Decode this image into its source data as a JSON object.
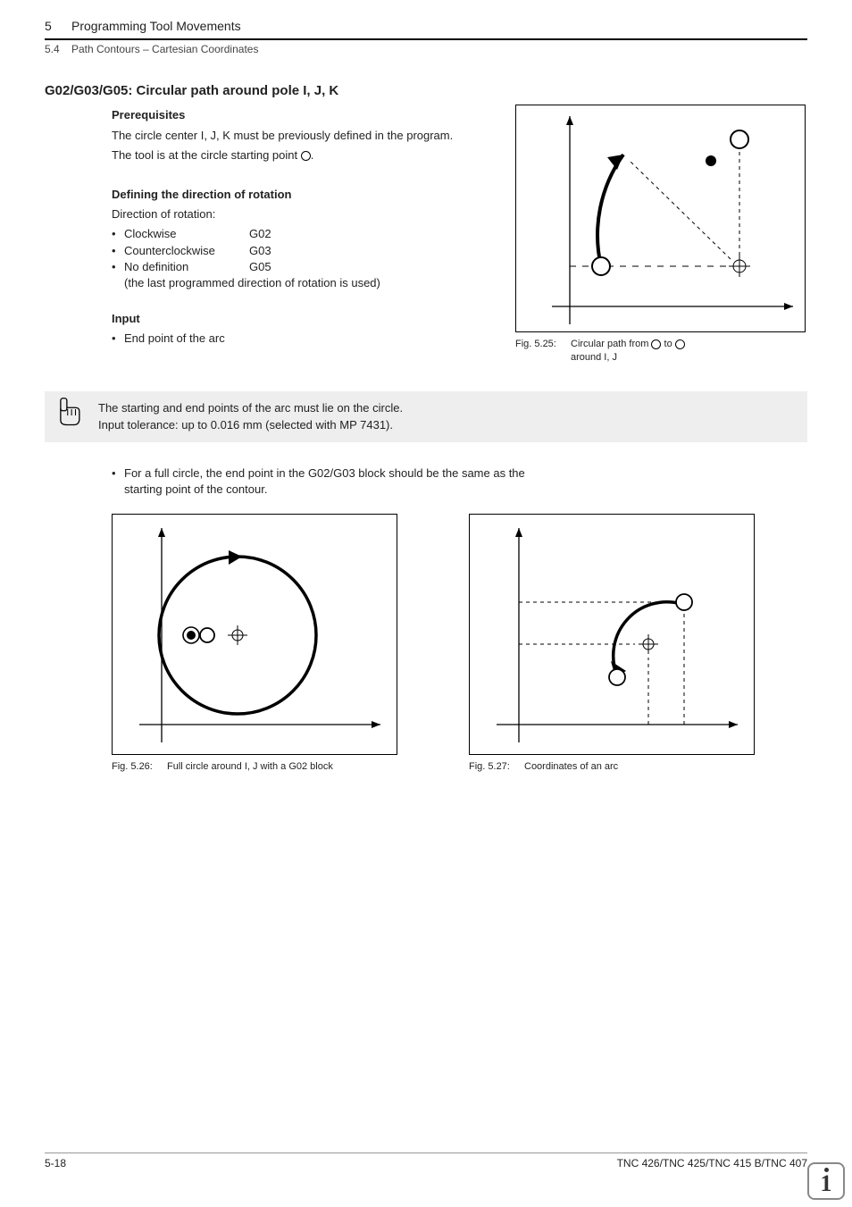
{
  "header": {
    "chapter_num": "5",
    "chapter_title": "Programming Tool Movements",
    "section_num": "5.4",
    "section_title": "Path Contours – Cartesian Coordinates"
  },
  "title": "G02/G03/G05: Circular path around pole I, J, K",
  "prereq": {
    "heading": "Prerequisites",
    "line1": "The circle center I, J, K must be previously defined in the program.",
    "line2a": "The tool is at the circle starting point ",
    "line2b": "."
  },
  "dir": {
    "heading": "Defining the direction of rotation",
    "intro": "Direction of rotation:",
    "items": [
      {
        "label": "Clockwise",
        "code": "G02"
      },
      {
        "label": "Counterclockwise",
        "code": "G03"
      },
      {
        "label": "No definition",
        "code": "G05"
      }
    ],
    "note": "(the last programmed direction of rotation is used)"
  },
  "input": {
    "heading": "Input",
    "item": "End point of the arc"
  },
  "notebox": {
    "line1": "The starting and end points of the arc must lie on the circle.",
    "line2": "Input tolerance: up to 0.016 mm (selected with MP 7431)."
  },
  "fullcircle_note": "For a full circle, the end point in the G02/G03 block should be the same as the starting point of the contour.",
  "fig525": {
    "label": "Fig. 5.25:",
    "caption_a": "Circular path from ",
    "caption_b": " to ",
    "caption_c": " around I, J"
  },
  "fig526": {
    "label": "Fig. 5.26:",
    "caption": "Full circle around I, J with a G02 block"
  },
  "fig527": {
    "label": "Fig. 5.27:",
    "caption": "Coordinates of an arc"
  },
  "footer": {
    "left": "5-18",
    "right": "TNC 426/TNC 425/TNC 415 B/TNC 407"
  }
}
